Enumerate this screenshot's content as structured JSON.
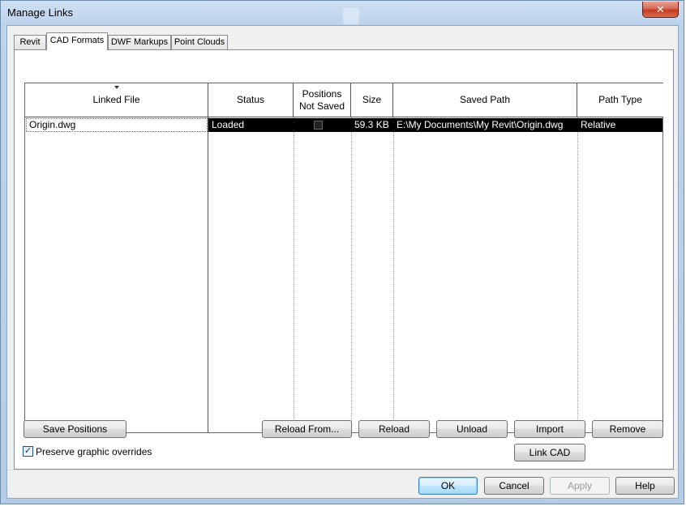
{
  "window": {
    "title": "Manage Links",
    "close_label": "✕"
  },
  "tabs": [
    {
      "label": "Revit"
    },
    {
      "label": "CAD Formats"
    },
    {
      "label": "DWF Markups"
    },
    {
      "label": "Point Clouds"
    }
  ],
  "table": {
    "columns": [
      "Linked File",
      "Status",
      "Positions Not Saved",
      "Size",
      "Saved Path",
      "Path Type"
    ],
    "rows": [
      {
        "linked_file": "Origin.dwg",
        "status": "Loaded",
        "positions_not_saved": false,
        "size": "59.3 KB",
        "saved_path": "E:\\My Documents\\My Revit\\Origin.dwg",
        "path_type": "Relative"
      }
    ]
  },
  "buttons": {
    "save_positions": "Save Positions",
    "reload_from": "Reload From...",
    "reload": "Reload",
    "unload": "Unload",
    "import": "Import",
    "remove": "Remove",
    "link_cad": "Link CAD",
    "ok": "OK",
    "cancel": "Cancel",
    "apply": "Apply",
    "help": "Help"
  },
  "preserve": {
    "label": "Preserve graphic overrides",
    "checked": true,
    "check_glyph": "✓"
  }
}
